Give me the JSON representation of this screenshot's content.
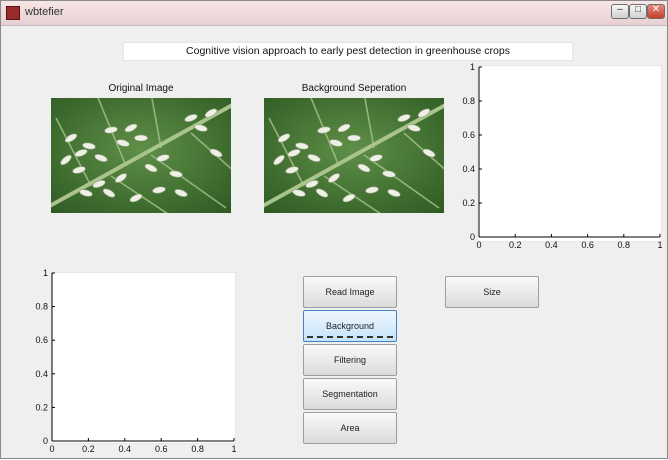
{
  "window": {
    "title": "wbtefier",
    "controls": {
      "minimize": "–",
      "maximize": "□",
      "close": "✕"
    }
  },
  "banner": {
    "text": "Cognitive vision approach to early pest detection in greenhouse crops"
  },
  "images": {
    "original_label": "Original Image",
    "background_label": "Background Seperation"
  },
  "plot_top_right": {
    "x_ticks": [
      "0",
      "0.2",
      "0.4",
      "0.6",
      "0.8",
      "1"
    ],
    "y_ticks": [
      "0",
      "0.2",
      "0.4",
      "0.6",
      "0.8",
      "1"
    ],
    "xlim": [
      0,
      1
    ],
    "ylim": [
      0,
      1
    ]
  },
  "plot_bottom_left": {
    "x_ticks": [
      "0",
      "0.2",
      "0.4",
      "0.6",
      "0.8",
      "1"
    ],
    "y_ticks": [
      "0",
      "0.2",
      "0.4",
      "0.6",
      "0.8",
      "1"
    ],
    "xlim": [
      0,
      1
    ],
    "ylim": [
      0,
      1
    ]
  },
  "buttons": {
    "read_image": "Read Image",
    "background_separation": "Background Seperation",
    "filtering": "Filtering",
    "segmentation": "Segmentation",
    "area": "Area",
    "size": "Size"
  },
  "colors": {
    "leaf_dark": "#2d5a22",
    "leaf_light": "#5f8f48",
    "vein": "#a9c48c",
    "pest": "#eef0e6",
    "focus_border": "#3f83c2"
  }
}
